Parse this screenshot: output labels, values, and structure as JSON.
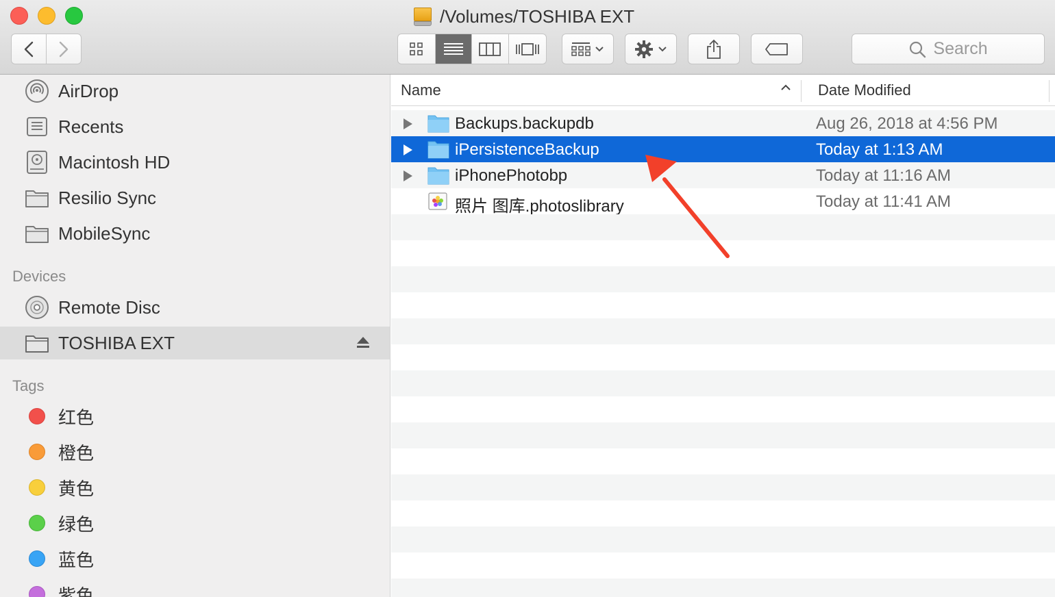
{
  "window": {
    "title": "/Volumes/TOSHIBA EXT"
  },
  "toolbar": {
    "search_placeholder": "Search",
    "view_modes": [
      "icon-view",
      "list-view",
      "column-view",
      "gallery-view"
    ],
    "active_view": "list-view"
  },
  "sidebar": {
    "favorites": [
      {
        "label": "AirDrop",
        "icon": "airdrop-icon"
      },
      {
        "label": "Recents",
        "icon": "recents-icon"
      },
      {
        "label": "Macintosh HD",
        "icon": "hard-drive-icon"
      },
      {
        "label": "Resilio Sync",
        "icon": "folder-icon"
      },
      {
        "label": "MobileSync",
        "icon": "folder-icon"
      }
    ],
    "devices_header": "Devices",
    "devices": [
      {
        "label": "Remote Disc",
        "icon": "disc-icon"
      },
      {
        "label": "TOSHIBA EXT",
        "icon": "folder-icon",
        "selected": true
      }
    ],
    "tags_header": "Tags",
    "tags": [
      {
        "label": "红色",
        "color": "#f2504b"
      },
      {
        "label": "橙色",
        "color": "#f99b38"
      },
      {
        "label": "黄色",
        "color": "#f8cf3c"
      },
      {
        "label": "绿色",
        "color": "#5bd04a"
      },
      {
        "label": "蓝色",
        "color": "#38a4f5"
      },
      {
        "label": "紫色",
        "color": "#c46fdc"
      }
    ]
  },
  "list": {
    "columns": {
      "name": "Name",
      "date": "Date Modified"
    },
    "rows": [
      {
        "name": "Backups.backupdb",
        "date": "Aug 26, 2018 at 4:56 PM",
        "kind": "folder",
        "selected": false
      },
      {
        "name": "iPersistenceBackup",
        "date": "Today at 1:13 AM",
        "kind": "folder",
        "selected": true
      },
      {
        "name": "iPhonePhotobp",
        "date": "Today at 11:16 AM",
        "kind": "folder",
        "selected": false
      },
      {
        "name": "照片 图库.photoslibrary",
        "date": "Today at 11:41 AM",
        "kind": "photos-library",
        "selected": false
      }
    ]
  },
  "colors": {
    "selection": "#0f68d8",
    "annotation_arrow": "#f2402a"
  }
}
